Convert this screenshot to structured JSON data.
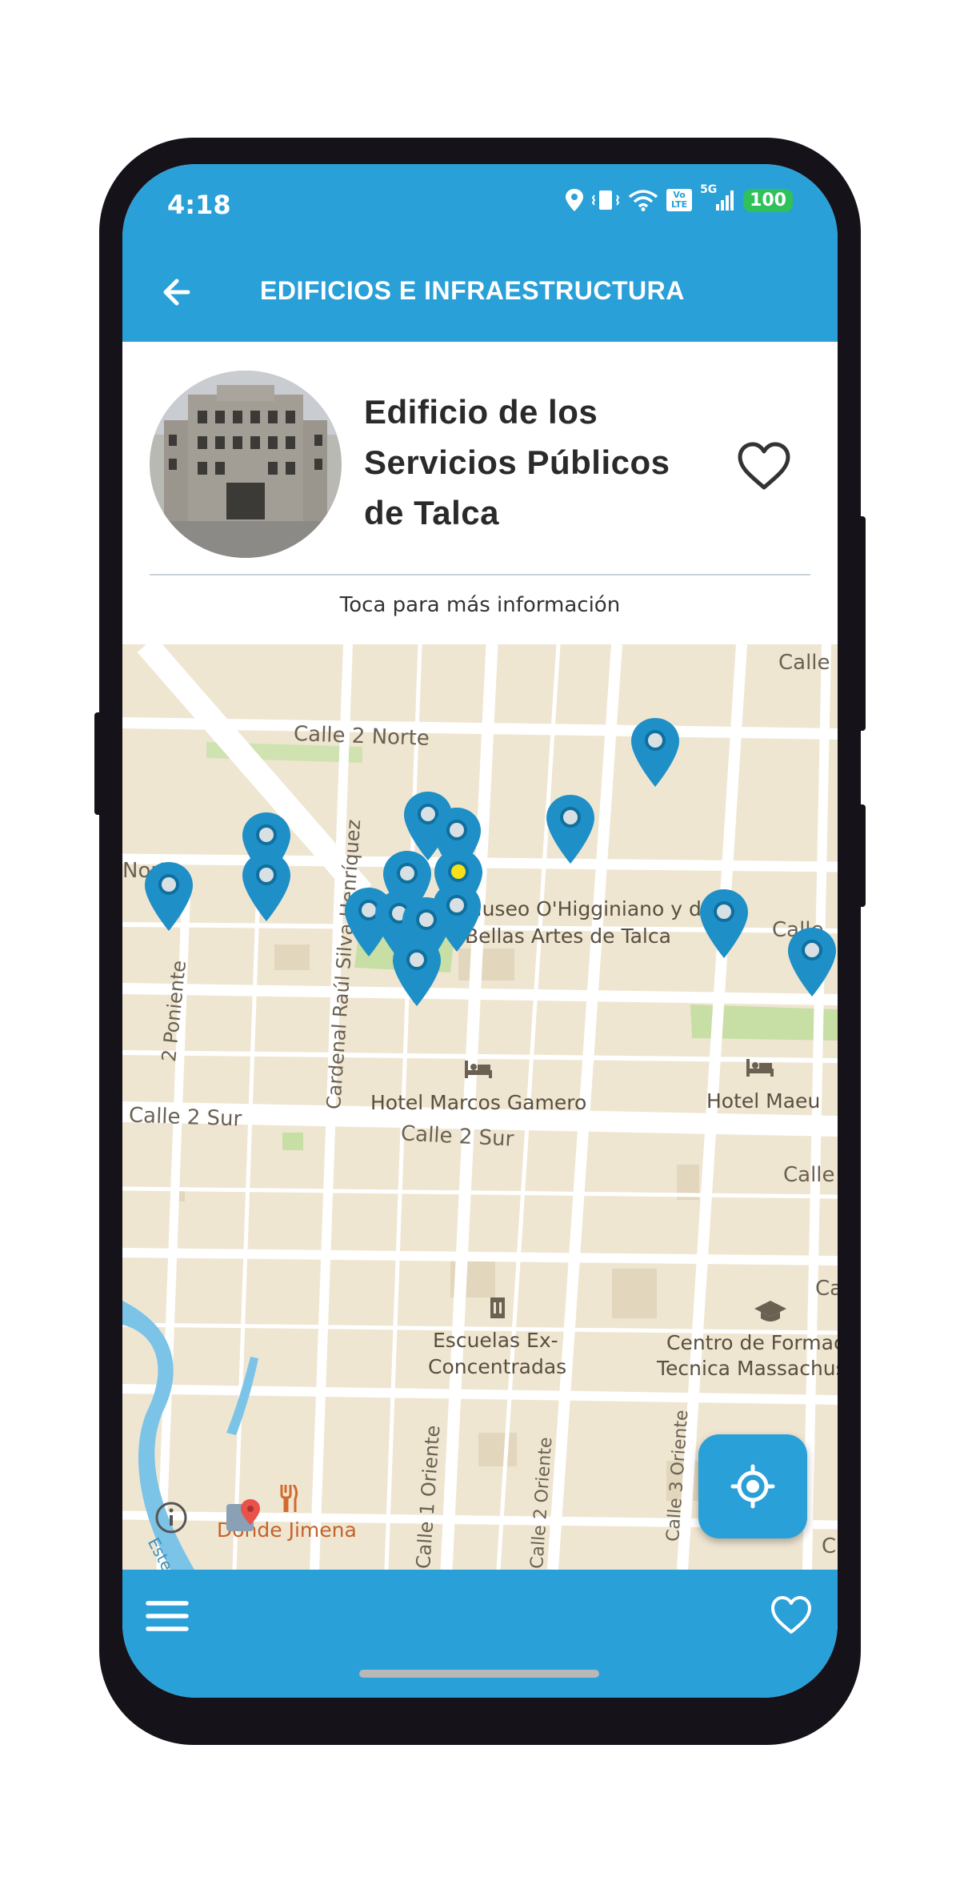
{
  "status": {
    "time": "4:18",
    "battery": "100",
    "network": "5G",
    "volte": "Vo LTE"
  },
  "appbar": {
    "title": "EDIFICIOS E INFRAESTRUCTURA"
  },
  "place": {
    "name": "Edificio de los Servicios Públicos de Talca",
    "hint": "Toca para más información"
  },
  "map": {
    "labels": {
      "calle2norte": "Calle 2 Norte",
      "norte": "Norte",
      "calle_top_right": "Calle",
      "calle_right1": "Calle",
      "calle_right2": "Calle",
      "calle_right3": "Ca",
      "calle_right4": "C",
      "museo1": "Museo O'Higginiano y de",
      "museo2": "Bellas Artes de Talca",
      "hotel1": "Hotel Marcos Gamero",
      "hotel2": "Hotel Maeu",
      "calle2sur_a": "Calle 2 Sur",
      "calle2sur_b": "Calle 2 Sur",
      "poniente": "2 Poniente",
      "cardenal": "Cardenal Raúl Silva Henríquez",
      "escuelas1": "Escuelas Ex-",
      "escuelas2": "Concentradas",
      "centro1": "Centro de Formación",
      "centro2": "Tecnica Massachusetts",
      "oriente1": "Calle 1 Oriente",
      "oriente2": "Calle 2 Oriente",
      "oriente3": "Calle 3 Oriente",
      "jimena": "Donde Jimena",
      "estero": "Estero"
    },
    "colors": {
      "background": "#efe6d2",
      "road": "#ffffff",
      "park": "#c7dfa5",
      "water": "#7cc3e8"
    }
  },
  "icons": {
    "back": "arrow-left-icon",
    "favorite": "heart-outline-icon",
    "menu": "hamburger-menu-icon",
    "locate": "crosshair-location-icon",
    "pin": "map-marker-icon",
    "info": "info-icon"
  },
  "colors": {
    "accent": "#29a0d8",
    "pin": "#1e8fc7",
    "pin_selected_dot": "#f7e017"
  }
}
